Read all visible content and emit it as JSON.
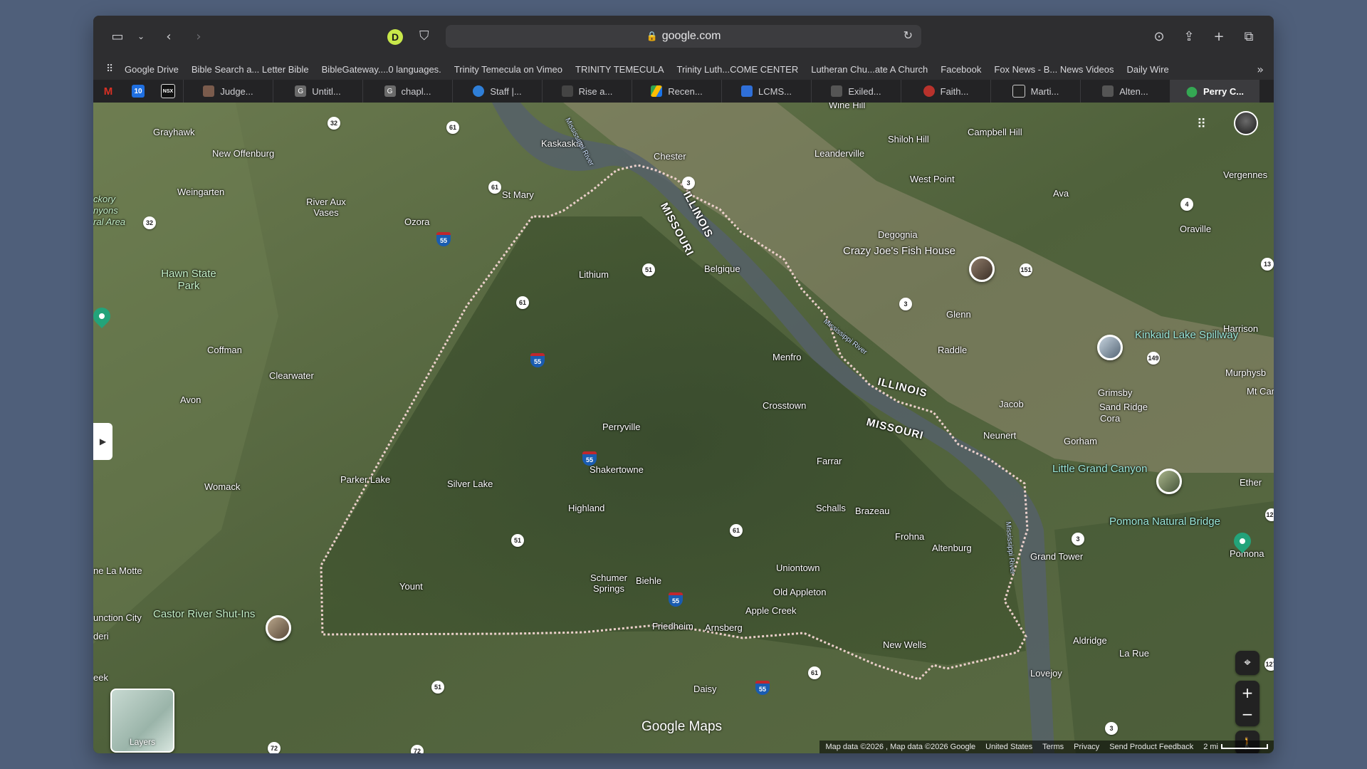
{
  "browser": {
    "url": "google.com",
    "profile_letter": "D"
  },
  "bookmarks": [
    "Google Drive",
    "Bible Search a... Letter Bible",
    "BibleGateway....0 languages.",
    "Trinity Temecula on Vimeo",
    "TRINITY TEMECULA",
    "Trinity Luth...COME CENTER",
    "Lutheran Chu...ate A Church",
    "Facebook",
    "Fox News - B... News Videos",
    "Daily Wire"
  ],
  "pinned_tabs": [
    {
      "glyph": "M",
      "color": "#d93025"
    },
    {
      "glyph": "10",
      "color": "#1f6fe0"
    },
    {
      "glyph": "NSX",
      "color": "#111111"
    }
  ],
  "tabs": [
    {
      "label": "Judge...",
      "color": "#7a5b4c"
    },
    {
      "label": "Untitl...",
      "color": "#6b6b6b"
    },
    {
      "label": "chapl...",
      "color": "#6b6b6b"
    },
    {
      "label": "Staff |...",
      "color": "#2f7fd8"
    },
    {
      "label": "Rise a...",
      "color": "#444444"
    },
    {
      "label": "Recen...",
      "color": "#2ea44f"
    },
    {
      "label": "LCMS...",
      "color": "#2f6fd8"
    },
    {
      "label": "Exiled...",
      "color": "#555555"
    },
    {
      "label": "Faith...",
      "color": "#b8322c"
    },
    {
      "label": "Marti...",
      "color": "#222222"
    },
    {
      "label": "Alten...",
      "color": "#555555"
    },
    {
      "label": "Perry C...",
      "color": "#34a853",
      "active": true
    }
  ],
  "map": {
    "brand": "Google Maps",
    "layers_label": "Layers",
    "footer": {
      "data": "Map data ©2026 , Map data ©2026 Google",
      "country": "United States",
      "terms": "Terms",
      "privacy": "Privacy",
      "feedback": "Send Product Feedback",
      "scale": "2 mi"
    },
    "places": {
      "grayhawk": "Grayhawk",
      "new_offenburg": "New Offenburg",
      "weingarten": "Weingarten",
      "hickory": "ckory",
      "canyons": "nyons",
      "natural_area": "ral Area",
      "river_aux_vases": "River Aux Vases",
      "ozora": "Ozora",
      "st_mary": "St Mary",
      "kaskaskia": "Kaskaskia",
      "chester": "Chester",
      "wine_hill": "Wine Hill",
      "shiloh_hill": "Shiloh Hill",
      "campbell_hill": "Campbell Hill",
      "vergennes": "Vergennes",
      "leanderville": "Leanderville",
      "west_point": "West Point",
      "ava": "Ava",
      "oraville": "Oraville",
      "degognia": "Degognia",
      "crazy_joes": "Crazy Joe's Fish House",
      "belgique": "Belgique",
      "lithium": "Lithium",
      "hawn_state_park": "Hawn State Park",
      "coffman": "Coffman",
      "clearwater": "Clearwater",
      "avon": "Avon",
      "glenn": "Glenn",
      "raddle": "Raddle",
      "harrison": "Harrison",
      "kinkaid": "Kinkaid Lake Spillway",
      "murphysb": "Murphysb",
      "mt_car": "Mt Car",
      "menfro": "Menfro",
      "crosstown": "Crosstown",
      "jacob": "Jacob",
      "grimsby": "Grimsby",
      "sand_ridge": "Sand Ridge",
      "cora": "Cora",
      "perryville": "Perryville",
      "neunert": "Neunert",
      "gorham": "Gorham",
      "little_grand_canyon": "Little Grand Canyon",
      "ether": "Ether",
      "shakertowne": "Shakertowne",
      "farrar": "Farrar",
      "womack": "Womack",
      "parker_lake": "Parker Lake",
      "silver_lake": "Silver Lake",
      "highland": "Highland",
      "schalls": "Schalls",
      "brazeau": "Brazeau",
      "pomona_natural_bridge": "Pomona Natural Bridge",
      "frohna": "Frohna",
      "altenburg": "Altenburg",
      "grand_tower": "Grand Tower",
      "pomona": "Pomona",
      "la_motte": "ne La Motte",
      "yount": "Yount",
      "schumer_springs": "Schumer Springs",
      "biehle": "Biehle",
      "uniontown": "Uniontown",
      "old_appleton": "Old Appleton",
      "apple_creek": "Apple Creek",
      "castor_river": "Castor River Shut-Ins",
      "junction_city": "unction City",
      "deri": "deri",
      "friedheim": "Friedheim",
      "arnsberg": "Arnsberg",
      "new_wells": "New Wells",
      "aldridge": "Aldridge",
      "la_rue": "La Rue",
      "lovejoy": "Lovejoy",
      "daisy": "Daisy",
      "eek": "eek",
      "illinois_1": "ILLINOIS",
      "missouri_1": "MISSOURI",
      "illinois_2": "ILLINOIS",
      "missouri_2": "MISSOURI",
      "mississippi_river_1": "Mississippi River",
      "mississippi_river_2": "Mississippi River",
      "mississippi_river_3": "Mississippi River"
    },
    "routes": {
      "r32a": "32",
      "r61a": "61",
      "r61b": "61",
      "r32b": "32",
      "r55a": "55",
      "r3a": "3",
      "r4": "4",
      "r151": "151",
      "r51a": "51",
      "r61c": "61",
      "r13": "13",
      "r3b": "3",
      "r55b": "55",
      "r149": "149",
      "r55c": "55",
      "r61d": "61",
      "r51b": "51",
      "r3c": "3",
      "r127a": "127",
      "r55d": "55",
      "r61e": "61",
      "r127b": "127",
      "r55e": "55",
      "r51c": "51",
      "r72a": "72",
      "r72b": "72",
      "r3d": "3"
    }
  }
}
